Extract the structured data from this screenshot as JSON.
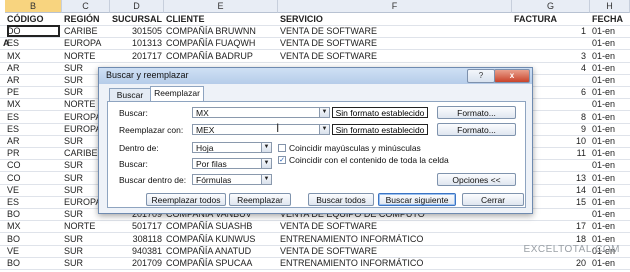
{
  "columns": [
    "B",
    "C",
    "D",
    "E",
    "F",
    "G",
    "H"
  ],
  "selected_column": "B",
  "row_a_marker": "A",
  "header_row": [
    "CÓDIGO",
    "REGIÓN",
    "SUCURSAL",
    "CLIENTE",
    "SERVICIO",
    "FACTURA",
    "FECHA"
  ],
  "rows": [
    [
      "DO",
      "CARIBE",
      "301505",
      "COMPAÑÍA BRUWNN",
      "VENTA DE SOFTWARE",
      "1",
      "01-en"
    ],
    [
      "ES",
      "EUROPA",
      "101313",
      "COMPAÑÍA FUAQWH",
      "VENTA DE SOFTWARE",
      "",
      "01-en"
    ],
    [
      "MX",
      "NORTE",
      "201717",
      "COMPAÑÍA BADRUP",
      "VENTA DE SOFTWARE",
      "3",
      "01-en"
    ],
    [
      "AR",
      "SUR",
      "",
      "",
      "",
      "4",
      "01-en"
    ],
    [
      "AR",
      "SUR",
      "",
      "",
      "",
      "",
      "01-en"
    ],
    [
      "PE",
      "SUR",
      "",
      "",
      "",
      "6",
      "01-en"
    ],
    [
      "MX",
      "NORTE",
      "",
      "",
      "",
      "",
      "01-en"
    ],
    [
      "ES",
      "EUROPA",
      "",
      "",
      "",
      "8",
      "01-en"
    ],
    [
      "ES",
      "EUROPA",
      "",
      "",
      "",
      "9",
      "01-en"
    ],
    [
      "AR",
      "SUR",
      "",
      "",
      "",
      "10",
      "01-en"
    ],
    [
      "PR",
      "CARIBE",
      "",
      "",
      "",
      "11",
      "01-en"
    ],
    [
      "CO",
      "SUR",
      "",
      "",
      "",
      "",
      "01-en"
    ],
    [
      "CO",
      "SUR",
      "",
      "",
      "",
      "13",
      "01-en"
    ],
    [
      "VE",
      "SUR",
      "",
      "",
      "",
      "14",
      "01-en"
    ],
    [
      "ES",
      "EUROPA",
      "",
      "",
      "",
      "15",
      "01-en"
    ],
    [
      "BO",
      "SUR",
      "201709",
      "COMPAÑÍA VANBUV",
      "VENTA DE EQUIPO DE COMPUTO",
      "",
      "01-en"
    ],
    [
      "MX",
      "NORTE",
      "501717",
      "COMPAÑÍA SUASHB",
      "VENTA DE SOFTWARE",
      "17",
      "01-en"
    ],
    [
      "BO",
      "SUR",
      "308118",
      "COMPAÑÍA KUNWUS",
      "ENTRENAMIENTO INFORMÁTICO",
      "18",
      "01-en"
    ],
    [
      "VE",
      "SUR",
      "940381",
      "COMPAÑÍA ANATUD",
      "VENTA DE SOFTWARE",
      "",
      "01-en"
    ],
    [
      "BO",
      "SUR",
      "201709",
      "COMPAÑÍA SPUCAA",
      "ENTRENAMIENTO INFORMÁTICO",
      "20",
      "01-en"
    ]
  ],
  "watermark": "EXCELTOTAL.COM",
  "dialog": {
    "title": "Buscar y reemplazar",
    "help_label": "?",
    "close_label": "x",
    "tabs": [
      "Buscar",
      "Reemplazar"
    ],
    "find_label": "Buscar:",
    "find_value": "MX",
    "replace_label": "Reemplazar con:",
    "replace_value": "MEX",
    "no_format_label": "Sin formato establecido",
    "format_button": "Formato...",
    "within_label": "Dentro de:",
    "within_value": "Hoja",
    "search_label": "Buscar:",
    "search_value": "Por filas",
    "lookin_label": "Buscar dentro de:",
    "lookin_value": "Fórmulas",
    "match_case_label": "Coincidir mayúsculas y minúsculas",
    "match_case_checked": false,
    "match_entire_label": "Coincidir con el contenido de toda la celda",
    "match_entire_checked": true,
    "options_button": "Opciones <<",
    "replace_all_button": "Reemplazar todos",
    "replace_button": "Reemplazar",
    "find_all_button": "Buscar todos",
    "find_next_button": "Buscar siguiente",
    "close_button": "Cerrar"
  }
}
